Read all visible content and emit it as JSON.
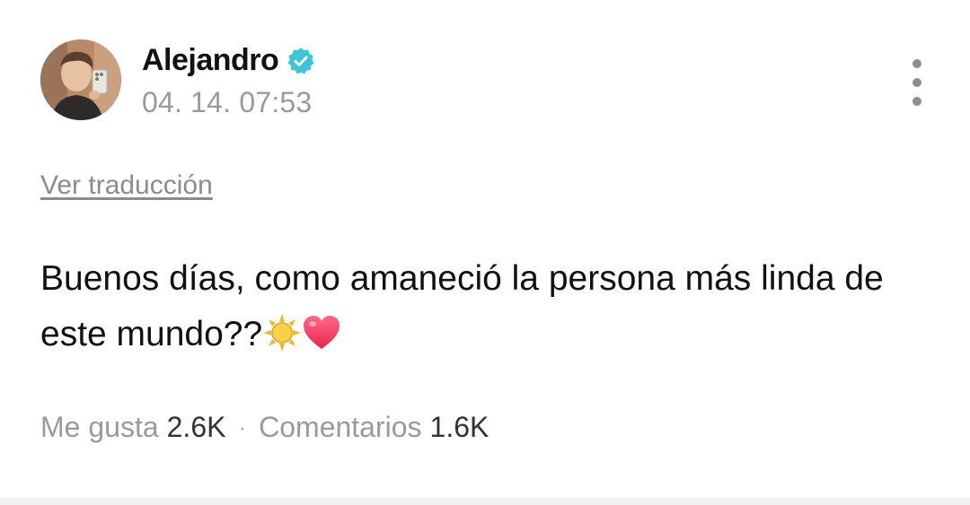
{
  "post": {
    "author": {
      "name": "Alejandro",
      "verified": true,
      "verified_color": "#3ec6d8",
      "avatar_icon": "profile-photo"
    },
    "timestamp": "04. 14. 07:53",
    "translate_label": "Ver traducción",
    "body": {
      "text": "Buenos días, como amaneció la persona más linda de este mundo??",
      "emojis": [
        "sun-emoji",
        "red-heart-emoji"
      ]
    },
    "stats": {
      "likes_label": "Me gusta",
      "likes_value": "2.6K",
      "separator": "·",
      "comments_label": "Comentarios",
      "comments_value": "1.6K"
    },
    "menu_icon": "more-vertical-icon"
  },
  "colors": {
    "text_primary": "#111111",
    "text_secondary": "#9a9a9a",
    "verified": "#3ec6d8",
    "divider": "#f1f1f1"
  }
}
